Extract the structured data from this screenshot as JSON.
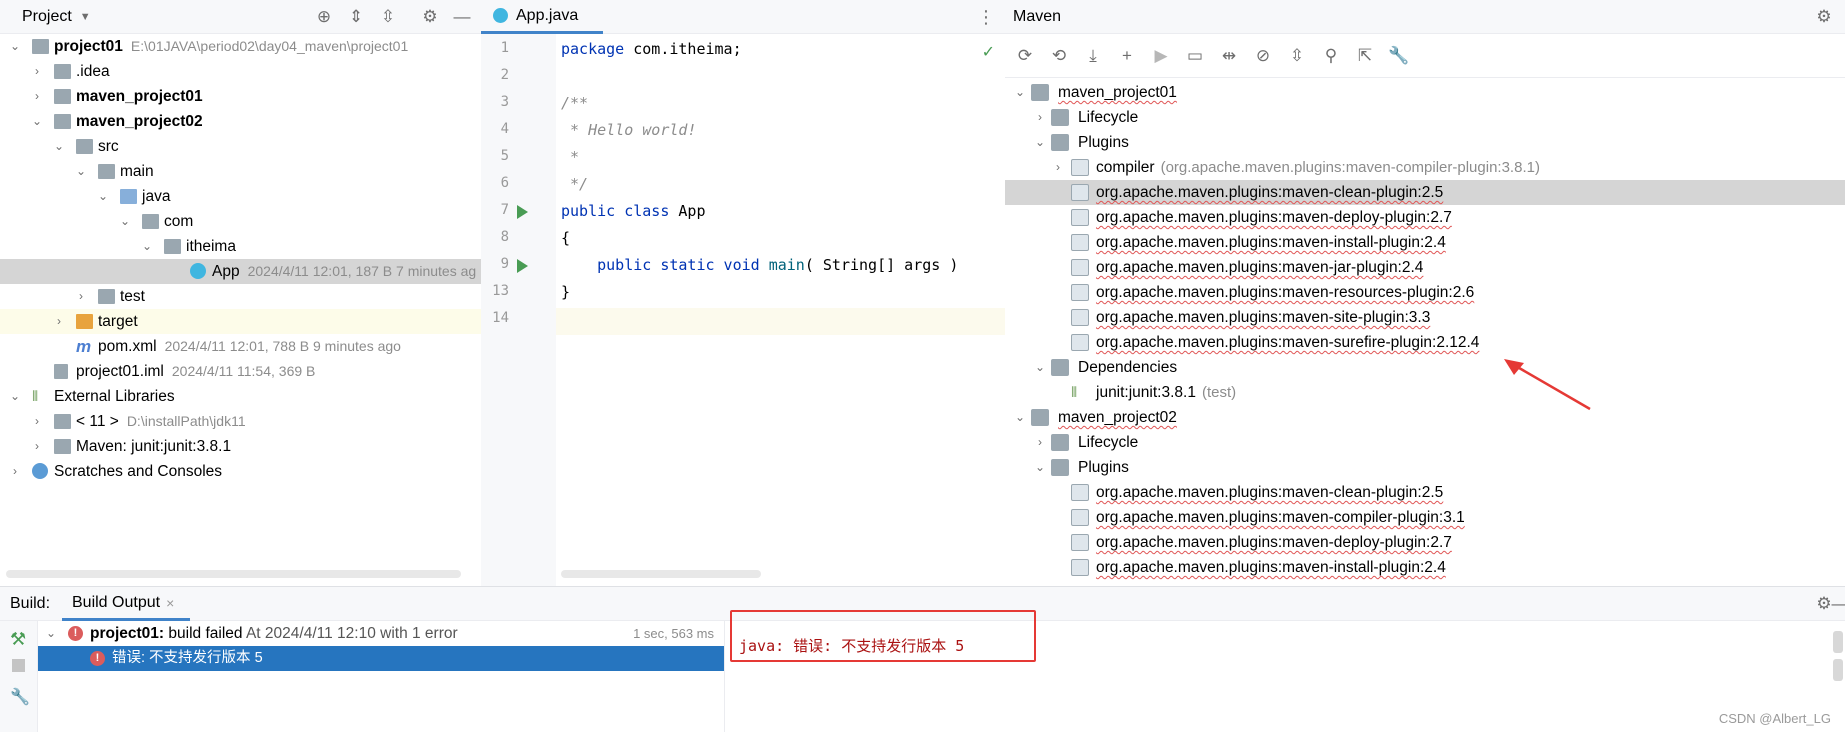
{
  "project_panel": {
    "title": "Project",
    "tree": [
      {
        "label": "project01",
        "meta": "E:\\01JAVA\\period02\\day04_maven\\project01"
      },
      {
        "label": ".idea"
      },
      {
        "label": "maven_project01"
      },
      {
        "label": "maven_project02"
      },
      {
        "label": "src"
      },
      {
        "label": "main"
      },
      {
        "label": "java"
      },
      {
        "label": "com"
      },
      {
        "label": "itheima"
      },
      {
        "label": "App",
        "meta": "2024/4/11 12:01, 187 B 7 minutes ag"
      },
      {
        "label": "test"
      },
      {
        "label": "target"
      },
      {
        "label": "pom.xml",
        "meta": "2024/4/11 12:01, 788 B 9 minutes ago"
      },
      {
        "label": "project01.iml",
        "meta": "2024/4/11 11:54, 369 B"
      },
      {
        "label": "External Libraries"
      },
      {
        "label": "< 11 >",
        "meta": "D:\\installPath\\jdk11"
      },
      {
        "label": "Maven: junit:junit:3.8.1"
      },
      {
        "label": "Scratches and Consoles"
      }
    ]
  },
  "editor": {
    "tab_label": "App.java",
    "lines": [
      {
        "num": "1",
        "code": "package com.itheima;"
      },
      {
        "num": "2",
        "code": ""
      },
      {
        "num": "3",
        "code": "/**"
      },
      {
        "num": "4",
        "code": " * Hello world!"
      },
      {
        "num": "5",
        "code": " *"
      },
      {
        "num": "6",
        "code": " */"
      },
      {
        "num": "7",
        "code": "public class App"
      },
      {
        "num": "8",
        "code": "{"
      },
      {
        "num": "9",
        "code": "    public static void main( String[] args )"
      },
      {
        "num": "13",
        "code": "}"
      },
      {
        "num": "14",
        "code": ""
      }
    ]
  },
  "maven_panel": {
    "title": "Maven",
    "tree": [
      {
        "label": "maven_project01"
      },
      {
        "label": "Lifecycle"
      },
      {
        "label": "Plugins"
      },
      {
        "label": "compiler",
        "meta": "(org.apache.maven.plugins:maven-compiler-plugin:3.8.1)"
      },
      {
        "label": "org.apache.maven.plugins:maven-clean-plugin:2.5"
      },
      {
        "label": "org.apache.maven.plugins:maven-deploy-plugin:2.7"
      },
      {
        "label": "org.apache.maven.plugins:maven-install-plugin:2.4"
      },
      {
        "label": "org.apache.maven.plugins:maven-jar-plugin:2.4"
      },
      {
        "label": "org.apache.maven.plugins:maven-resources-plugin:2.6"
      },
      {
        "label": "org.apache.maven.plugins:maven-site-plugin:3.3"
      },
      {
        "label": "org.apache.maven.plugins:maven-surefire-plugin:2.12.4"
      },
      {
        "label": "Dependencies"
      },
      {
        "label": "junit:junit:3.8.1",
        "meta": "(test)"
      },
      {
        "label": "maven_project02"
      },
      {
        "label": "Lifecycle"
      },
      {
        "label": "Plugins"
      },
      {
        "label": "org.apache.maven.plugins:maven-clean-plugin:2.5"
      },
      {
        "label": "org.apache.maven.plugins:maven-compiler-plugin:3.1"
      },
      {
        "label": "org.apache.maven.plugins:maven-deploy-plugin:2.7"
      },
      {
        "label": "org.apache.maven.plugins:maven-install-plugin:2.4"
      }
    ]
  },
  "build": {
    "label": "Build:",
    "tab_label": "Build Output",
    "result_project": "project01:",
    "result_text": "build failed",
    "result_meta": "At 2024/4/11 12:10 with 1 error",
    "duration": "1 sec, 563 ms",
    "error_item": "错误: 不支持发行版本 5",
    "output_text": "java: 错误: 不支持发行版本 5"
  },
  "watermark": "CSDN @Albert_LG",
  "colors": {
    "selection": "#2675bf",
    "error": "#db5c5c",
    "annotation": "#e53935",
    "keyword": "#0033b3"
  }
}
